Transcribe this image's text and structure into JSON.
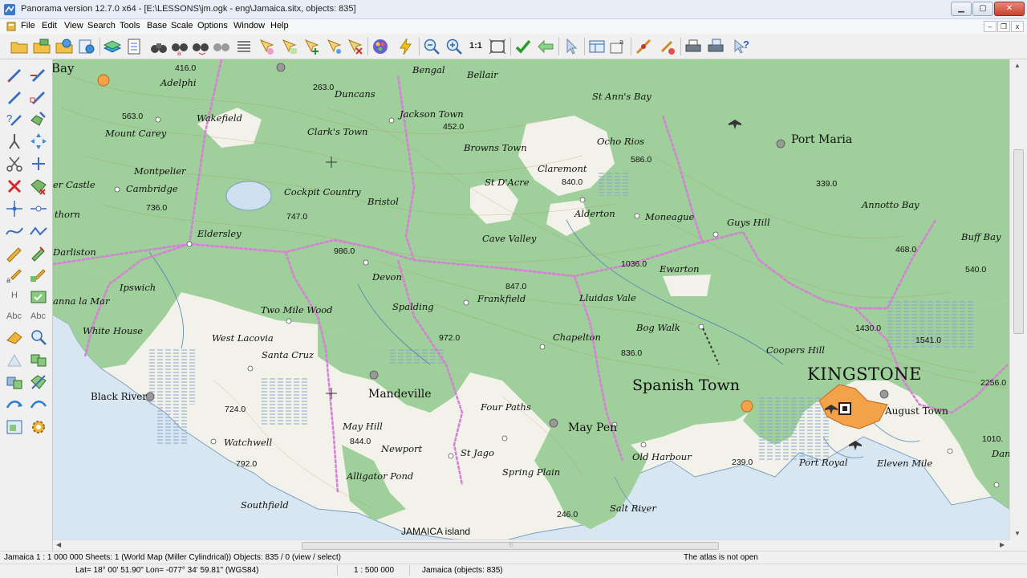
{
  "window": {
    "title": "Panorama version 12.7.0 x64 - [E:\\LESSONS\\jm.ogk - eng\\Jamaica.sitx, objects: 835]",
    "minimize": "▁",
    "maximize": "▢",
    "close": "✕",
    "mdi_minimize": "–",
    "mdi_restore": "❐",
    "mdi_close": "x"
  },
  "menu": [
    "File",
    "Edit",
    "View",
    "Search",
    "Tools",
    "Base",
    "Scale",
    "Options",
    "Window",
    "Help"
  ],
  "toolbar": {
    "scale_label": "1:1"
  },
  "left_tools": {
    "h_label": "H",
    "abc_label_1": "Abc",
    "abc_label_2": "Abc"
  },
  "map": {
    "colors": {
      "water": "#d8e6f2",
      "forest": "#9fcf9a",
      "open_land": "#f3f2ea",
      "road": "#d67fd6",
      "city": "#f4a24a",
      "contour": "#b48a5a"
    },
    "place_names": {
      "bay": "Bay",
      "bengal": "Bengal",
      "bellair": "Bellair",
      "adelphi": "Adelphi",
      "duncans": "Duncans",
      "st_anns_bay": "St Ann's Bay",
      "jackson_town": "Jackson Town",
      "wakefield": "Wakefield",
      "clarks_town": "Clark's Town",
      "browns_town": "Browns Town",
      "ocho_rios": "Ocho Rios",
      "port_maria": "Port Maria",
      "mount_carey": "Mount Carey",
      "montpelier": "Montpelier",
      "claremont": "Claremont",
      "st_dacre": "St D'Acre",
      "cockpit_country": "Cockpit Country",
      "river_castle": "er Castle",
      "cambridge": "Cambridge",
      "bristol": "Bristol",
      "alderton": "Alderton",
      "moneague": "Moneague",
      "guys_hill": "Guys Hill",
      "annotto_bay": "Annotto Bay",
      "buff_bay": "Buff Bay",
      "anchovy": "thorn",
      "eldersley": "Eldersley",
      "cave_valley": "Cave Valley",
      "darliston": "Darliston",
      "ewarton": "Ewarton",
      "devon": "Devon",
      "ipswich": "Ipswich",
      "frankfield": "Frankfield",
      "lluidas_vale": "Lluidas Vale",
      "spalding": "Spalding",
      "savanna_la_mar": "anna la Mar",
      "two_mile_wood": "Two Mile Wood",
      "white_house": "White House",
      "bog_walk": "Bog Walk",
      "west_lacovia": "West Lacovia",
      "chapelton": "Chapelton",
      "coopers_hill": "Coopers Hill",
      "santa_cruz": "Santa Cruz",
      "black_river": "Black River",
      "mandeville": "Mandeville",
      "four_paths": "Four Paths",
      "may_hill": "May Hill",
      "may_pen": "May Pen",
      "august_town": "August Town",
      "watchwell": "Watchwell",
      "newport": "Newport",
      "st_jago": "St Jago",
      "old_harbour": "Old Harbour",
      "port_royal": "Port Royal",
      "eleven_mile": "Eleven Mile",
      "spring_plain": "Spring Plain",
      "alligator_pond": "Alligator Pond",
      "southfield": "Southfield",
      "salt_river": "Salt River",
      "dam": "Dam",
      "spanish_town": "Spanish Town",
      "kingstone": "KINGSTONE",
      "jamaica_island": "JAMAICA island"
    },
    "elevations": {
      "e416": "416.0",
      "e263": "263.0",
      "e563": "563.0",
      "e452": "452.0",
      "e586": "586.0",
      "e339": "339.0",
      "e840": "840.0",
      "e736": "736.0",
      "e747": "747.0",
      "e468": "468.0",
      "e540": "540.0",
      "e986": "986.0",
      "e1036": "1036.0",
      "e847": "847.0",
      "e972": "972.0",
      "e836": "836.0",
      "e1430": "1430.0",
      "e1541": "1541.0",
      "e2256": "2256.0",
      "e724": "724.0",
      "e844": "844.0",
      "e792": "792.0",
      "e239": "239.0",
      "e246": "246.0",
      "e1010": "1010."
    }
  },
  "status": {
    "row1_left": "Jamaica  1 : 1 000 000  Sheets: 1   (World Map (Miller Cylindrical))  Objects: 835 / 0 (view / select)",
    "row1_right": "The atlas is not open",
    "coords": "Lat= 18° 00' 51.90\"   Lon= -077° 34' 59.81\"  (WGS84)",
    "scale": "1 : 500 000",
    "map_info": "Jamaica   (objects: 835)"
  }
}
